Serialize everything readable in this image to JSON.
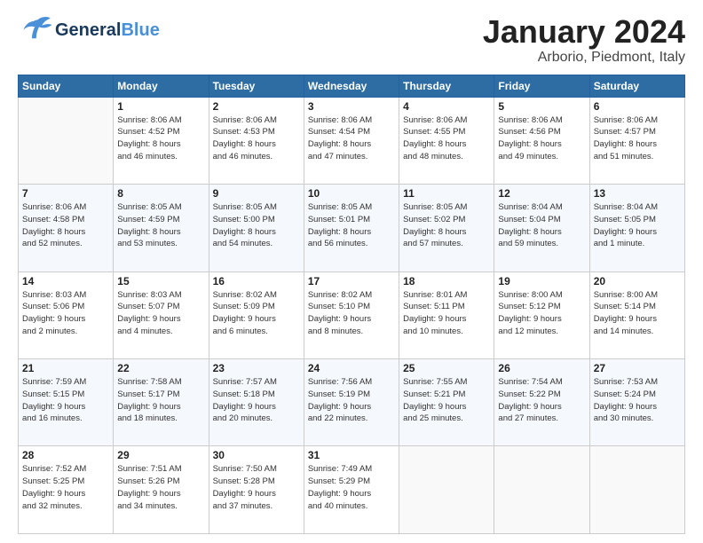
{
  "header": {
    "logo_general": "General",
    "logo_blue": "Blue",
    "month_title": "January 2024",
    "location": "Arborio, Piedmont, Italy"
  },
  "weekdays": [
    "Sunday",
    "Monday",
    "Tuesday",
    "Wednesday",
    "Thursday",
    "Friday",
    "Saturday"
  ],
  "weeks": [
    [
      {
        "day": "",
        "info": ""
      },
      {
        "day": "1",
        "info": "Sunrise: 8:06 AM\nSunset: 4:52 PM\nDaylight: 8 hours\nand 46 minutes."
      },
      {
        "day": "2",
        "info": "Sunrise: 8:06 AM\nSunset: 4:53 PM\nDaylight: 8 hours\nand 46 minutes."
      },
      {
        "day": "3",
        "info": "Sunrise: 8:06 AM\nSunset: 4:54 PM\nDaylight: 8 hours\nand 47 minutes."
      },
      {
        "day": "4",
        "info": "Sunrise: 8:06 AM\nSunset: 4:55 PM\nDaylight: 8 hours\nand 48 minutes."
      },
      {
        "day": "5",
        "info": "Sunrise: 8:06 AM\nSunset: 4:56 PM\nDaylight: 8 hours\nand 49 minutes."
      },
      {
        "day": "6",
        "info": "Sunrise: 8:06 AM\nSunset: 4:57 PM\nDaylight: 8 hours\nand 51 minutes."
      }
    ],
    [
      {
        "day": "7",
        "info": "Sunrise: 8:06 AM\nSunset: 4:58 PM\nDaylight: 8 hours\nand 52 minutes."
      },
      {
        "day": "8",
        "info": "Sunrise: 8:05 AM\nSunset: 4:59 PM\nDaylight: 8 hours\nand 53 minutes."
      },
      {
        "day": "9",
        "info": "Sunrise: 8:05 AM\nSunset: 5:00 PM\nDaylight: 8 hours\nand 54 minutes."
      },
      {
        "day": "10",
        "info": "Sunrise: 8:05 AM\nSunset: 5:01 PM\nDaylight: 8 hours\nand 56 minutes."
      },
      {
        "day": "11",
        "info": "Sunrise: 8:05 AM\nSunset: 5:02 PM\nDaylight: 8 hours\nand 57 minutes."
      },
      {
        "day": "12",
        "info": "Sunrise: 8:04 AM\nSunset: 5:04 PM\nDaylight: 8 hours\nand 59 minutes."
      },
      {
        "day": "13",
        "info": "Sunrise: 8:04 AM\nSunset: 5:05 PM\nDaylight: 9 hours\nand 1 minute."
      }
    ],
    [
      {
        "day": "14",
        "info": "Sunrise: 8:03 AM\nSunset: 5:06 PM\nDaylight: 9 hours\nand 2 minutes."
      },
      {
        "day": "15",
        "info": "Sunrise: 8:03 AM\nSunset: 5:07 PM\nDaylight: 9 hours\nand 4 minutes."
      },
      {
        "day": "16",
        "info": "Sunrise: 8:02 AM\nSunset: 5:09 PM\nDaylight: 9 hours\nand 6 minutes."
      },
      {
        "day": "17",
        "info": "Sunrise: 8:02 AM\nSunset: 5:10 PM\nDaylight: 9 hours\nand 8 minutes."
      },
      {
        "day": "18",
        "info": "Sunrise: 8:01 AM\nSunset: 5:11 PM\nDaylight: 9 hours\nand 10 minutes."
      },
      {
        "day": "19",
        "info": "Sunrise: 8:00 AM\nSunset: 5:12 PM\nDaylight: 9 hours\nand 12 minutes."
      },
      {
        "day": "20",
        "info": "Sunrise: 8:00 AM\nSunset: 5:14 PM\nDaylight: 9 hours\nand 14 minutes."
      }
    ],
    [
      {
        "day": "21",
        "info": "Sunrise: 7:59 AM\nSunset: 5:15 PM\nDaylight: 9 hours\nand 16 minutes."
      },
      {
        "day": "22",
        "info": "Sunrise: 7:58 AM\nSunset: 5:17 PM\nDaylight: 9 hours\nand 18 minutes."
      },
      {
        "day": "23",
        "info": "Sunrise: 7:57 AM\nSunset: 5:18 PM\nDaylight: 9 hours\nand 20 minutes."
      },
      {
        "day": "24",
        "info": "Sunrise: 7:56 AM\nSunset: 5:19 PM\nDaylight: 9 hours\nand 22 minutes."
      },
      {
        "day": "25",
        "info": "Sunrise: 7:55 AM\nSunset: 5:21 PM\nDaylight: 9 hours\nand 25 minutes."
      },
      {
        "day": "26",
        "info": "Sunrise: 7:54 AM\nSunset: 5:22 PM\nDaylight: 9 hours\nand 27 minutes."
      },
      {
        "day": "27",
        "info": "Sunrise: 7:53 AM\nSunset: 5:24 PM\nDaylight: 9 hours\nand 30 minutes."
      }
    ],
    [
      {
        "day": "28",
        "info": "Sunrise: 7:52 AM\nSunset: 5:25 PM\nDaylight: 9 hours\nand 32 minutes."
      },
      {
        "day": "29",
        "info": "Sunrise: 7:51 AM\nSunset: 5:26 PM\nDaylight: 9 hours\nand 34 minutes."
      },
      {
        "day": "30",
        "info": "Sunrise: 7:50 AM\nSunset: 5:28 PM\nDaylight: 9 hours\nand 37 minutes."
      },
      {
        "day": "31",
        "info": "Sunrise: 7:49 AM\nSunset: 5:29 PM\nDaylight: 9 hours\nand 40 minutes."
      },
      {
        "day": "",
        "info": ""
      },
      {
        "day": "",
        "info": ""
      },
      {
        "day": "",
        "info": ""
      }
    ]
  ]
}
